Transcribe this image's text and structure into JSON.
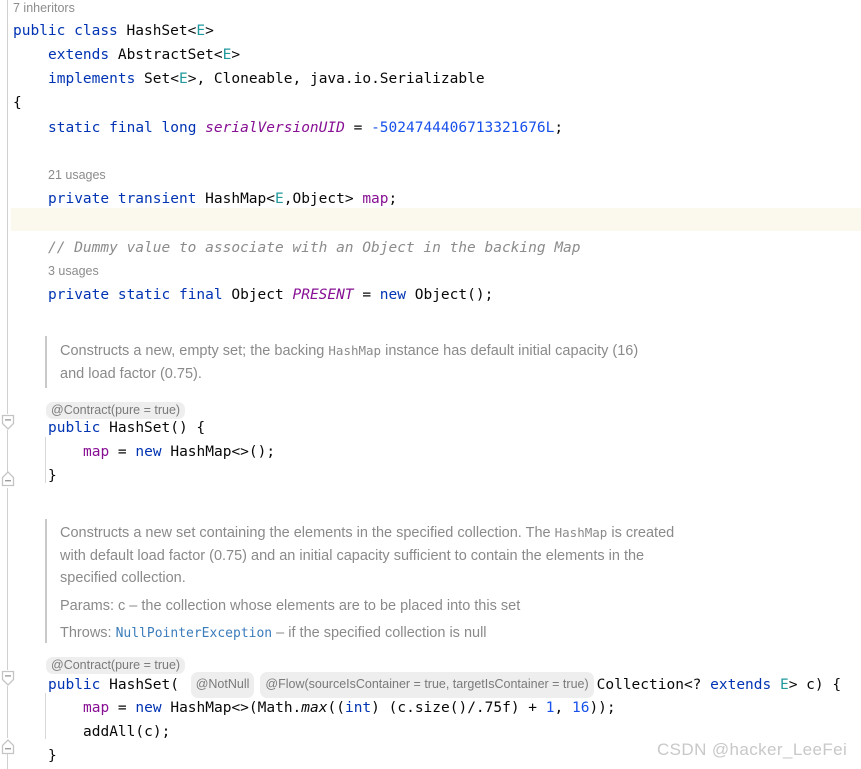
{
  "editor": {
    "file_language": "Java",
    "colors": {
      "background": "#ffffff",
      "keyword": "#0033b3",
      "number": "#1750eb",
      "field": "#871094",
      "type_param": "#20999d",
      "comment": "#8c8c8c",
      "doc_text": "#8a8a8a",
      "doc_link": "#3b7cbb",
      "inlay_bg": "#eeeeee",
      "caret_line_bg": "#fbf8ee",
      "gutter_line": "#d0d0d0",
      "watermark": "#c8c8c8"
    },
    "code_vision": {
      "inheritors": "7 inheritors",
      "usages_map": "21 usages",
      "usages_present": "3 usages"
    },
    "class_declaration": {
      "line1": {
        "kw_public": "public",
        "kw_class": "class",
        "name": "HashSet",
        "lt": "<",
        "type_param": "E",
        "gt": ">"
      },
      "line2": {
        "kw_extends": "extends",
        "super": "AbstractSet",
        "lt": "<",
        "type_param": "E",
        "gt": ">"
      },
      "line3": {
        "kw_implements": "implements",
        "iface1": "Set",
        "lt": "<",
        "type_param": "E",
        "gt_comma": ">, ",
        "iface2": "Cloneable",
        "comma2": ", ",
        "iface3": "java.io.Serializable"
      },
      "open_brace": "{"
    },
    "fields": [
      {
        "name": "serialVersionUID",
        "modifiers": "static final long",
        "kw_static": "static",
        "kw_final": "final",
        "kw_long": "long",
        "assign": " = ",
        "value": "-5024744406713321676L",
        "semicolon": ";"
      },
      {
        "kw_private": "private",
        "kw_transient": "transient",
        "type": "HashMap",
        "lt": "<",
        "type_param": "E",
        "comma": ",",
        "type_arg2": "Object",
        "gt": "> ",
        "name": "map",
        "semicolon": ";"
      },
      {
        "comment": "// Dummy value to associate with an Object in the backing Map",
        "kw_private": "private",
        "kw_static": "static",
        "kw_final": "final",
        "type": "Object",
        "name": "PRESENT",
        "assign": " = ",
        "kw_new": "new",
        "ctor": "Object();"
      }
    ],
    "constructors": [
      {
        "doc": {
          "paragraphs": [
            {
              "segments": [
                {
                  "kind": "text",
                  "text": "Constructs a new, empty set; the backing "
                },
                {
                  "kind": "mono",
                  "text": "HashMap"
                },
                {
                  "kind": "text",
                  "text": " instance has default initial capacity (16) and load factor (0.75)."
                }
              ]
            }
          ]
        },
        "inlay_contract": "@Contract(pure = true)",
        "signature": {
          "kw_public": "public",
          "name": "HashSet",
          "params": "() {"
        },
        "body": [
          {
            "field": "map",
            "rest": " = ",
            "kw_new": "new",
            "tail": " HashMap<>();"
          }
        ],
        "close_brace": "}"
      },
      {
        "doc": {
          "paragraphs": [
            {
              "segments": [
                {
                  "kind": "text",
                  "text": "Constructs a new set containing the elements in the specified collection. The "
                },
                {
                  "kind": "mono",
                  "text": "HashMap"
                },
                {
                  "kind": "text",
                  "text": " is created with default load factor (0.75) and an initial capacity sufficient to contain the elements in the specified collection."
                }
              ]
            },
            {
              "segments": [
                {
                  "kind": "text",
                  "text": "Params: c – the collection whose elements are to be placed into this set"
                }
              ]
            },
            {
              "segments": [
                {
                  "kind": "text",
                  "text": "Throws: "
                },
                {
                  "kind": "link",
                  "text": "NullPointerException"
                },
                {
                  "kind": "text",
                  "text": " – if the specified collection is null"
                }
              ]
            }
          ]
        },
        "inlay_contract": "@Contract(pure = true)",
        "signature": {
          "kw_public": "public",
          "name": "HashSet",
          "open_paren": "( ",
          "inlay_notnull": "@NotNull",
          "inlay_flow": "@Flow(sourceIsContainer = true, targetIsContainer = true)",
          "param_type": "Collection<? ",
          "kw_extends": "extends",
          "type_param": "E",
          "param_tail": "> c) {"
        },
        "body": [
          {
            "field": "map",
            "rest": " = ",
            "kw_new": "new",
            "tail_a": " HashMap<>(Math.",
            "smethod": "max",
            "tail_b": "((",
            "kw_int": "int",
            "tail_c": ") (c.size()/.75f) + ",
            "num1": "1",
            "tail_d": ", ",
            "num2": "16",
            "tail_e": "));"
          },
          {
            "plain": "addAll(c);"
          }
        ],
        "close_brace": "}"
      }
    ],
    "watermark": "CSDN @hacker_LeeFei"
  }
}
